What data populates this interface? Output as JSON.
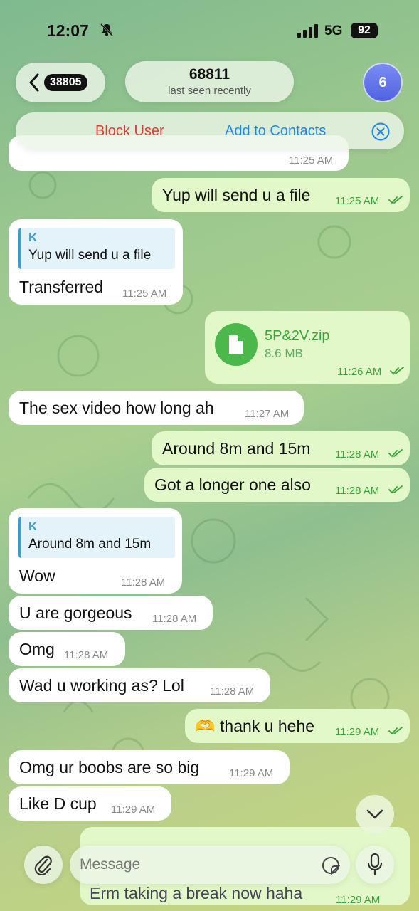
{
  "status": {
    "time": "12:07",
    "network": "5G",
    "battery": "92"
  },
  "header": {
    "back_count": "38805",
    "contact_name": "68811",
    "last_seen": "last seen recently",
    "avatar_count": "6"
  },
  "actions": {
    "block": "Block User",
    "add_contact": "Add to Contacts"
  },
  "messages": [
    {
      "id": "m0",
      "dir": "in",
      "text": "",
      "time": "11:25 AM"
    },
    {
      "id": "m1",
      "dir": "out",
      "text": "Yup will send u a file",
      "time": "11:25 AM"
    },
    {
      "id": "m2",
      "dir": "in",
      "reply_name": "K",
      "reply_text": "Yup will send u a file",
      "text": "Transferred",
      "time": "11:25 AM"
    },
    {
      "id": "m3",
      "dir": "out",
      "file_name": "5P&2V.zip",
      "file_size": "8.6 MB",
      "time": "11:26 AM"
    },
    {
      "id": "m4",
      "dir": "in",
      "text": "The sex video how long ah",
      "time": "11:27 AM"
    },
    {
      "id": "m5",
      "dir": "out",
      "text": "Around 8m and 15m",
      "time": "11:28 AM"
    },
    {
      "id": "m6",
      "dir": "out",
      "text": "Got a longer one also",
      "time": "11:28 AM"
    },
    {
      "id": "m7",
      "dir": "in",
      "reply_name": "K",
      "reply_text": "Around 8m and 15m",
      "text": "Wow",
      "time": "11:28 AM"
    },
    {
      "id": "m8",
      "dir": "in",
      "text": "U are gorgeous",
      "time": "11:28 AM"
    },
    {
      "id": "m9",
      "dir": "in",
      "text": "Omg",
      "time": "11:28 AM"
    },
    {
      "id": "m10",
      "dir": "in",
      "text": "Wad u working as? Lol",
      "time": "11:28 AM"
    },
    {
      "id": "m11",
      "dir": "out",
      "text": "🫶 thank u hehe",
      "time": "11:29 AM"
    },
    {
      "id": "m12",
      "dir": "in",
      "text": "Omg ur boobs are so big",
      "time": "11:29 AM"
    },
    {
      "id": "m13",
      "dir": "in",
      "text": "Like D cup",
      "time": "11:29 AM"
    },
    {
      "id": "m14",
      "dir": "out",
      "text": "Erm taking a break now haha",
      "time": "11:29 AM"
    }
  ],
  "composer": {
    "placeholder": "Message"
  },
  "icons": {
    "back": "chevron-left-icon",
    "close": "close-circle-icon",
    "file": "file-icon",
    "scroll": "chevron-down-icon",
    "attach": "paperclip-icon",
    "sticker": "sticker-icon",
    "mic": "microphone-icon"
  },
  "colors": {
    "outgoing_bubble": "#e2f8c8",
    "incoming_bubble": "#ffffff",
    "accent_green": "#3aa33a",
    "block_red": "#e53935",
    "link_blue": "#1e88e5"
  }
}
